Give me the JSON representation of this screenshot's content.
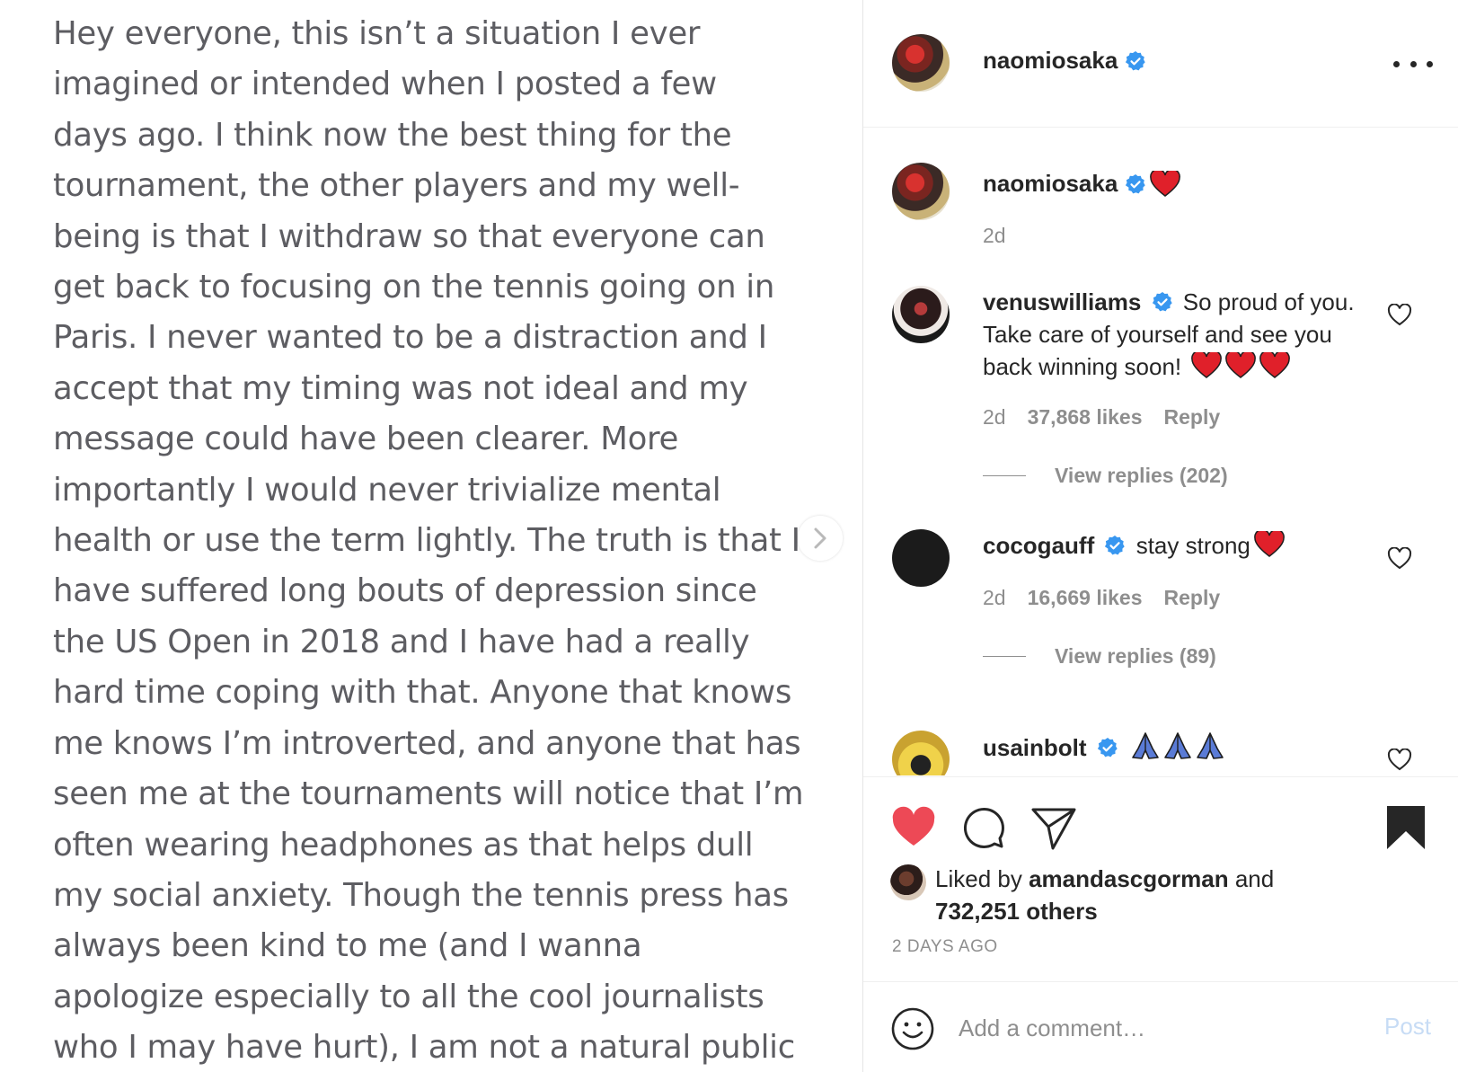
{
  "post_image": {
    "note_lines": [
      "Hey everyone, this isn’t a situation I ever",
      "imagined or intended when I posted a few",
      "days ago. I think now the best thing for the",
      "tournament, the other players and my well-",
      "being is that I withdraw so that everyone can",
      "get back to focusing on the tennis going on in",
      "Paris. I never wanted to be a distraction and I",
      "accept that my timing was not ideal and my",
      "message could have been clearer. More",
      "importantly I would never trivialize mental",
      "health or use the term lightly. The truth is that I",
      "have suffered long bouts of depression since",
      "the US Open in 2018 and I have had a really",
      "hard time coping with that. Anyone that knows",
      "me knows I’m introverted, and anyone that has",
      "seen me at the tournaments will notice that I’m",
      "often wearing headphones as that helps dull",
      "my social anxiety. Though the tennis press has",
      "always been kind to me (and I wanna",
      "apologize especially to all the cool journalists",
      "who I may have hurt), I am not a natural public"
    ],
    "next_icon": "chevron-right-icon"
  },
  "header": {
    "username": "naomiosaka",
    "more_icon": "more-horizontal-icon"
  },
  "comments": [
    {
      "username": "naomiosaka",
      "text": "",
      "emoji": "red-heart",
      "time": "2d"
    },
    {
      "username": "venuswilliams",
      "text": "So proud of you. Take care of yourself and see you back winning soon!",
      "emoji": "red-heart x3",
      "time": "2d",
      "likes": "37,868 likes",
      "reply": "Reply",
      "view_replies": "View replies (202)"
    },
    {
      "username": "cocogauff",
      "text": "stay strong",
      "emoji": "red-heart",
      "time": "2d",
      "likes": "16,669 likes",
      "reply": "Reply",
      "view_replies": "View replies (89)"
    },
    {
      "username": "usainbolt",
      "text": "",
      "emoji": "folded-hands x3"
    }
  ],
  "actions": {
    "liked_prefix": "Liked by",
    "liked_user": "amandascgorman",
    "liked_and": "and",
    "liked_others": "732,251 others",
    "posted_ago": "2 DAYS AGO"
  },
  "add_comment": {
    "placeholder": "Add a comment…",
    "post_label": "Post"
  },
  "colors": {
    "heart_red": "#ed4956",
    "verified_blue": "#3897f0",
    "muted": "#8e8e8e",
    "text": "#262626"
  }
}
